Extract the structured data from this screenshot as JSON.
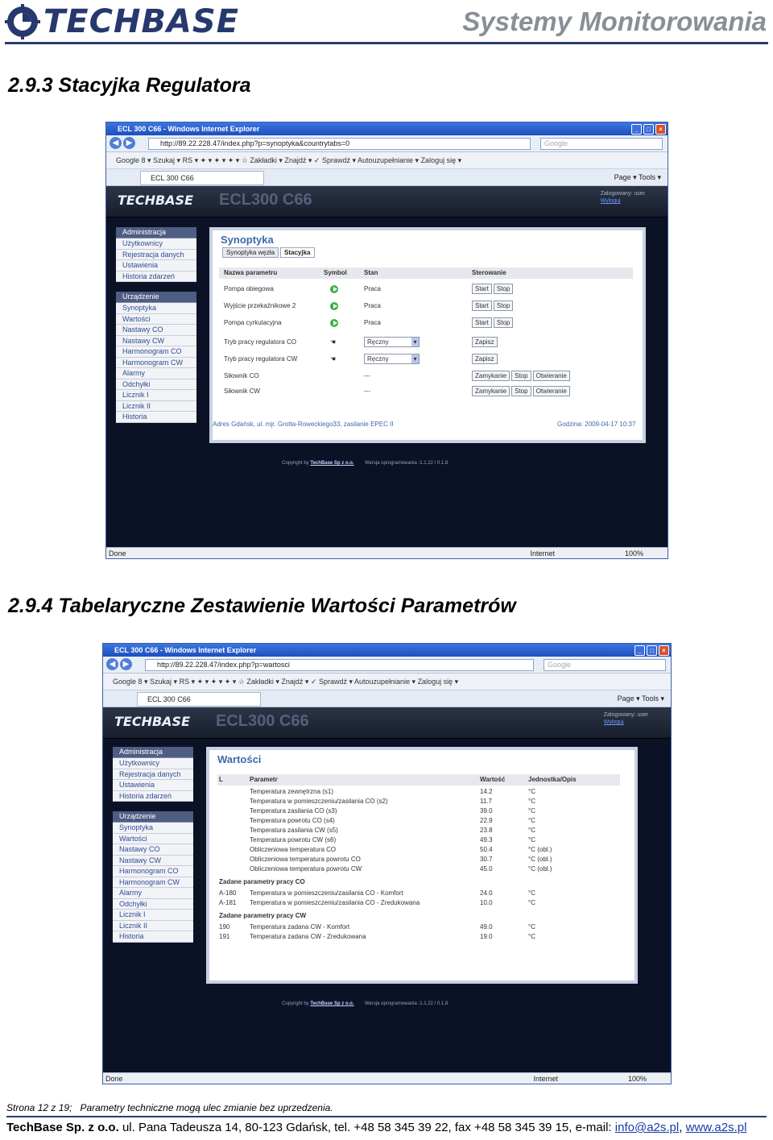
{
  "header": {
    "logo": "TECHBASE",
    "tagline": "Systemy Monitorowania"
  },
  "sec1": {
    "title": "2.9.3 Stacyjka Regulatora"
  },
  "sec2": {
    "title": "2.9.4 Tabelaryczne Zestawienie Wartości Parametrów"
  },
  "browser1": {
    "window_title": "ECL 300 C66 - Windows Internet Explorer",
    "url": "http://89.22.228.47/index.php?p=synoptyka&countrytabs=0",
    "search": "Google",
    "gbar": "Google  8 ▾    Szukaj ▾  RS ▾   ✦ ▾   ✦ ▾   ✦ ▾   ☆ Zakładki ▾   Znajdź ▾   ✓ Sprawdź ▾   Autouzupełnianie ▾   Zaloguj się ▾",
    "tab": "ECL 300 C66",
    "tools": "Page ▾   Tools ▾",
    "app_logo": "TECHBASE",
    "app_name": "ECL300 C66",
    "user": "Zalogowany: user",
    "logout": "Wyloguj",
    "status_done": "Done",
    "status_zone": "Internet",
    "status_zoom": "100%"
  },
  "browser2": {
    "window_title": "ECL 300 C66 - Windows Internet Explorer",
    "url": "http://89.22.228.47/index.php?p=wartosci",
    "search": "Google",
    "gbar": "Google  8 ▾    Szukaj ▾  RS ▾   ✦ ▾   ✦ ▾   ✦ ▾   ☆ Zakładki ▾   Znajdź ▾   ✓ Sprawdź ▾   Autouzupełnianie ▾   Zaloguj się ▾",
    "tab": "ECL 300 C66",
    "tools": "Page ▾   Tools ▾",
    "app_logo": "TECHBASE",
    "app_name": "ECL300 C66",
    "user": "Zalogowany: user",
    "logout": "Wyloguj",
    "status_done": "Done",
    "status_zone": "Internet",
    "status_zoom": "100%"
  },
  "menu_admin": [
    "Administracja",
    "Użytkownicy",
    "Rejestracja danych",
    "Ustawienia",
    "Historia zdarzeń"
  ],
  "menu_dev": [
    "Urządzenie",
    "Synoptyka",
    "Wartości",
    "Nastawy CO",
    "Nastawy CW",
    "Harmonogram CO",
    "Harmonogram CW",
    "Alarmy",
    "Odchyłki",
    "Licznik I",
    "Licznik II",
    "Historia"
  ],
  "synoptyka": {
    "title": "Synoptyka",
    "tab1": "Synoptyka węzła",
    "tab2": "Stacyjka",
    "headers": {
      "name": "Nazwa parametru",
      "symbol": "Symbol",
      "state": "Stan",
      "control": "Sterowanie"
    },
    "rows": [
      {
        "name": "Pompa obiegowa",
        "state": "Praca"
      },
      {
        "name": "Wyjście przekaźnikowe 2",
        "state": "Praca"
      },
      {
        "name": "Pompa cyrkulacyjna",
        "state": "Praca"
      }
    ],
    "modes": [
      {
        "name": "Tryb pracy regulatora CO",
        "value": "Ręczny"
      },
      {
        "name": "Tryb pracy regulatora CW",
        "value": "Ręczny"
      }
    ],
    "actuators": [
      {
        "name": "Siłownik CO",
        "state": "---"
      },
      {
        "name": "Siłownik CW",
        "state": "---"
      }
    ],
    "btn_start": "Start",
    "btn_stop": "Stop",
    "btn_save": "Zapisz",
    "btn_close": "Zamykanie",
    "btn_open": "Otwieranie",
    "address": "Adres Gdańsk, ul. mjr. Grotta-Roweckiego33, zasilanie EPEC II",
    "time": "Godzina: 2009-04-17 10:37"
  },
  "copyright": {
    "prefix": "Copyright by",
    "company": "TechBase Sp z o.o.",
    "version": "Wersja oprogramowania :1.1.22 / 0.1.8"
  },
  "wartosci": {
    "title": "Wartości",
    "headers": {
      "l": "L",
      "param": "Parametr",
      "value": "Wartość",
      "unit": "Jednostka/Opis"
    },
    "rows": [
      {
        "l": "",
        "p": "Temperatura zewnętrzna (s1)",
        "v": "14.2",
        "u": "°C"
      },
      {
        "l": "",
        "p": "Temperatura w pomieszczeniu/zasilania CO (s2)",
        "v": "11.7",
        "u": "°C"
      },
      {
        "l": "",
        "p": "Temperatura zasilania CO (s3)",
        "v": "39.0",
        "u": "°C"
      },
      {
        "l": "",
        "p": "Temperatura powrotu CO (s4)",
        "v": "22.9",
        "u": "°C"
      },
      {
        "l": "",
        "p": "Temperatura zasilania CW (s5)",
        "v": "23.8",
        "u": "°C"
      },
      {
        "l": "",
        "p": "Temperatura powrotu CW (s6)",
        "v": "49.3",
        "u": "°C"
      },
      {
        "l": "",
        "p": "Obliczeniowa temperatura CO",
        "v": "50.4",
        "u": "°C (obl.)"
      },
      {
        "l": "",
        "p": "Obliczeniowa temperatura powrotu CO",
        "v": "30.7",
        "u": "°C (obl.)"
      },
      {
        "l": "",
        "p": "Obliczeniowa temperatura powrotu CW",
        "v": "45.0",
        "u": "°C (obl.)"
      }
    ],
    "group1": "Zadane parametry pracy CO",
    "rows1": [
      {
        "l": "A-180",
        "p": "Temperatura w pomieszczeniu/zasilania CO - Komfort",
        "v": "24.0",
        "u": "°C"
      },
      {
        "l": "A-181",
        "p": "Temperatura w pomieszczeniu/zasilania CO - Zredukowana",
        "v": "10.0",
        "u": "°C"
      }
    ],
    "group2": "Zadane parametry pracy CW",
    "rows2": [
      {
        "l": "190",
        "p": "Temperatura zadana CW - Komfort",
        "v": "49.0",
        "u": "°C"
      },
      {
        "l": "191",
        "p": "Temperatura zadana CW - Zredukowana",
        "v": "19.0",
        "u": "°C"
      }
    ]
  },
  "footer": {
    "page_prefix": "Strona",
    "page": "12",
    "page_of": "z",
    "pages": "19;",
    "note": "Parametry techniczne mogą ulec zmianie bez uprzedzenia.",
    "company": "TechBase Sp. z o.o.",
    "address": "ul. Pana Tadeusza 14, 80-123 Gdańsk, tel. +48 58 345 39 22, fax +48 58 345 39 15,  e-mail:",
    "email": "info@a2s.pl",
    "sep": ",",
    "web": "www.a2s.pl"
  },
  "colors": {
    "brand": "#26386d",
    "link": "#3a6aa9",
    "ok": "#3ab04a"
  }
}
